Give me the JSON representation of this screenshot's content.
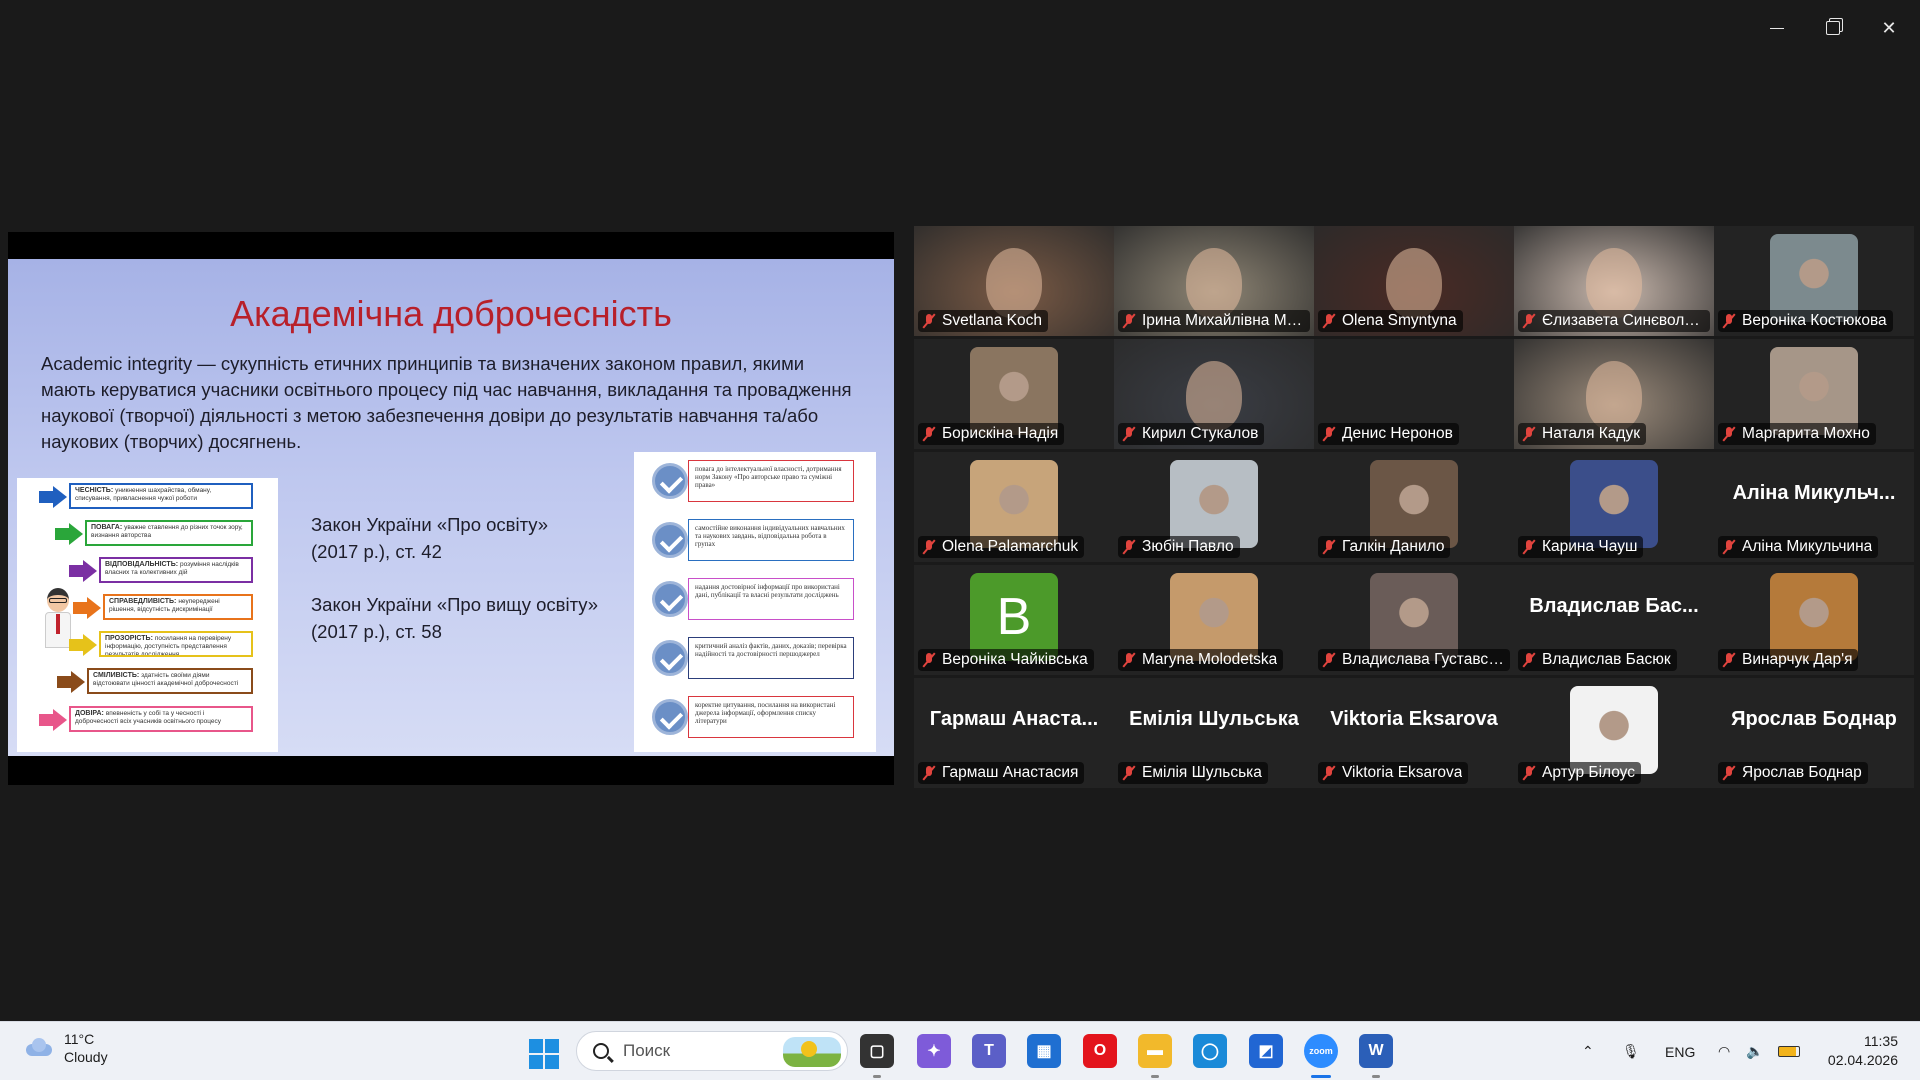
{
  "slide": {
    "title": "Академічна доброчесність",
    "definition": "Academic integrity — сукупність етичних принципів та визначених законом правил, якими мають керуватися учасники освітнього процесу під час навчання, викладання та провадження наукової (творчої) діяльності з метою забезпечення довіри до результатів навчання та/або наукових (творчих) досягнень.",
    "law1_line1": "Закон України «Про освіту»",
    "law1_line2": "(2017 р.), ст. 42",
    "law2_line1": "Закон України «Про вищу освіту»",
    "law2_line2": "(2017 р.), ст. 58",
    "infographic": [
      {
        "label": "ЧЕСНІСТЬ:",
        "text": "уникнення шахрайства, обману, списування, привласнення чужої роботи",
        "color": "#1f5fbf"
      },
      {
        "label": "ПОВАГА:",
        "text": "уважне ставлення до різних точок зору, визнання авторства",
        "color": "#2aa63a"
      },
      {
        "label": "ВІДПОВІДАЛЬНІСТЬ:",
        "text": "розуміння наслідків власних та колективних дій",
        "color": "#7b2fa3"
      },
      {
        "label": "СПРАВЕДЛИВІСТЬ:",
        "text": "неупереджені рішення, відсутність дискримінації",
        "color": "#e8731b"
      },
      {
        "label": "ПРОЗОРІСТЬ:",
        "text": "посилання на перевірену інформацію, доступність представлення результатів дослідження",
        "color": "#e6c21a"
      },
      {
        "label": "СМІЛИВІСТЬ:",
        "text": "здатність своїми діями відстоювати цінності академічної доброчесності",
        "color": "#8a4b1a"
      },
      {
        "label": "ДОВІРА:",
        "text": "впевненість у собі та у чесності і доброчесності всіх учасників освітнього процесу",
        "color": "#e8568a"
      }
    ],
    "checklist": [
      {
        "text": "повага до інтелектуальної власності, дотримання норм Закону «Про авторське право та суміжні права»",
        "color": "#d9363e"
      },
      {
        "text": "самостійне виконання індивідуальних навчальних та наукових завдань, відповідальна робота в групах",
        "color": "#2a6fc0"
      },
      {
        "text": "надання достовірної інформації про використані дані, публікації та власні результати досліджень",
        "color": "#c84fc9"
      },
      {
        "text": "критичний аналіз фактів, даних, доказів; перевірка надійності та достовірності першоджерел",
        "color": "#2c3e7a"
      },
      {
        "text": "коректне цитування, посилання на використані джерела інформації, оформлення списку літератури",
        "color": "#d9363e"
      }
    ]
  },
  "participants": [
    {
      "name": "Svetlana Koch",
      "kind": "video",
      "bg": "#7a5a45"
    },
    {
      "name": "Ірина Михайлівна Милос...",
      "kind": "video",
      "bg": "#8f8675"
    },
    {
      "name": "Olena Smyntyna",
      "kind": "video",
      "bg": "#4a2a24",
      "speaking": true
    },
    {
      "name": "Єлизавета Синєволно...",
      "kind": "video",
      "bg": "#c9b8ad"
    },
    {
      "name": "Вероніка Костюкова",
      "kind": "photo",
      "bg": "#7c8a8e"
    },
    {
      "name": "Борискіна Надія",
      "kind": "photo",
      "bg": "#8a7560"
    },
    {
      "name": "Кирил Стукалов",
      "kind": "video",
      "bg": "#3a3d44"
    },
    {
      "name": "Денис Неронов",
      "kind": "empty"
    },
    {
      "name": "Наталя Кадук",
      "kind": "video",
      "bg": "#9a8a7a"
    },
    {
      "name": "Маргарита Мохно",
      "kind": "photo",
      "bg": "#a69688"
    },
    {
      "name": "Olena Palamarchuk",
      "kind": "photo",
      "bg": "#c7a47a"
    },
    {
      "name": "Зюбін Павло",
      "kind": "photo",
      "bg": "#b7bec4"
    },
    {
      "name": "Галкін Данило",
      "kind": "photo",
      "bg": "#6b5646"
    },
    {
      "name": "Карина Чауш",
      "kind": "photo",
      "bg": "#3b4e8a"
    },
    {
      "name": "Аліна Микульчина",
      "kind": "text",
      "big": "Аліна  Микульч..."
    },
    {
      "name": "Вероніка Чайківська",
      "kind": "letter",
      "letter": "B"
    },
    {
      "name": "Maryna Molodetska",
      "kind": "photo",
      "bg": "#c59a6b"
    },
    {
      "name": "Владислава Густавсон...",
      "kind": "photo",
      "bg": "#6a5c58"
    },
    {
      "name": "Владислав Басюк",
      "kind": "text",
      "big": "Владислав  Бас..."
    },
    {
      "name": "Винарчук Дар'я",
      "kind": "photo",
      "bg": "#b57a3a"
    },
    {
      "name": "Гармаш Анастасия",
      "kind": "text",
      "big": "Гармаш  Анаста..."
    },
    {
      "name": "Емілія Шульська",
      "kind": "text",
      "big": "Емілія Шульська"
    },
    {
      "name": "Viktoria Eksarova",
      "kind": "text",
      "big": "Viktoria Eksarova"
    },
    {
      "name": "Артур Білоус",
      "kind": "photo",
      "bg": "#f2f2f2"
    },
    {
      "name": "Ярослав Боднар",
      "kind": "text",
      "big": "Ярослав Боднар"
    }
  ],
  "taskbar": {
    "temperature": "11°C",
    "weather": "Cloudy",
    "search_placeholder": "Поиск",
    "language": "ENG",
    "time": "11:35",
    "date": "02.04.2026",
    "apps": [
      {
        "name": "task-view-icon",
        "color": "#333333",
        "glyph": "▢"
      },
      {
        "name": "copilot-icon",
        "color": "#7e5bd9",
        "glyph": "✦"
      },
      {
        "name": "teams-icon",
        "color": "#5b5fc7",
        "glyph": "T"
      },
      {
        "name": "store-icon",
        "color": "#1f6fd1",
        "glyph": "▦"
      },
      {
        "name": "opera-icon",
        "color": "#e3141c",
        "glyph": "O"
      },
      {
        "name": "file-explorer-icon",
        "color": "#f2b92b",
        "glyph": "▬"
      },
      {
        "name": "cortana-icon",
        "color": "#1a8ad8",
        "glyph": "◯"
      },
      {
        "name": "app-icon",
        "color": "#2166d3",
        "glyph": "◩"
      },
      {
        "name": "zoom-icon",
        "color": "#2d8cff",
        "glyph": "zoom"
      },
      {
        "name": "word-icon",
        "color": "#2b5fb8",
        "glyph": "W"
      }
    ]
  }
}
